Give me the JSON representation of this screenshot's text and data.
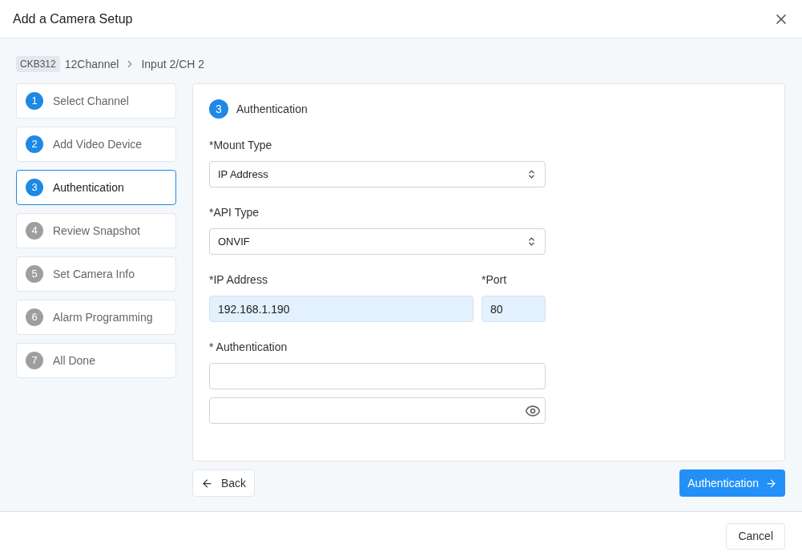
{
  "dialog": {
    "title": "Add a Camera Setup"
  },
  "breadcrumb": {
    "badge": "CKB312",
    "device": "12Channel",
    "channel": "Input 2/CH 2"
  },
  "steps": [
    {
      "number": "1",
      "label": "Select Channel",
      "reached": true,
      "selected": false
    },
    {
      "number": "2",
      "label": "Add Video Device",
      "reached": true,
      "selected": false
    },
    {
      "number": "3",
      "label": "Authentication",
      "reached": true,
      "selected": true
    },
    {
      "number": "4",
      "label": "Review Snapshot",
      "reached": false,
      "selected": false
    },
    {
      "number": "5",
      "label": "Set Camera Info",
      "reached": false,
      "selected": false
    },
    {
      "number": "6",
      "label": "Alarm Programming",
      "reached": false,
      "selected": false
    },
    {
      "number": "7",
      "label": "All Done",
      "reached": false,
      "selected": false
    }
  ],
  "panel": {
    "number": "3",
    "title": "Authentication",
    "mount_type": {
      "label": "*Mount Type",
      "value": "IP Address"
    },
    "api_type": {
      "label": "*API Type",
      "value": "ONVIF"
    },
    "ip_address": {
      "label": "*IP Address",
      "value": "192.168.1.190"
    },
    "port": {
      "label": "*Port",
      "value": "80"
    },
    "authentication": {
      "label": "* Authentication"
    }
  },
  "back_button": "Back",
  "next_button": "Authentication",
  "cancel_button": "Cancel"
}
